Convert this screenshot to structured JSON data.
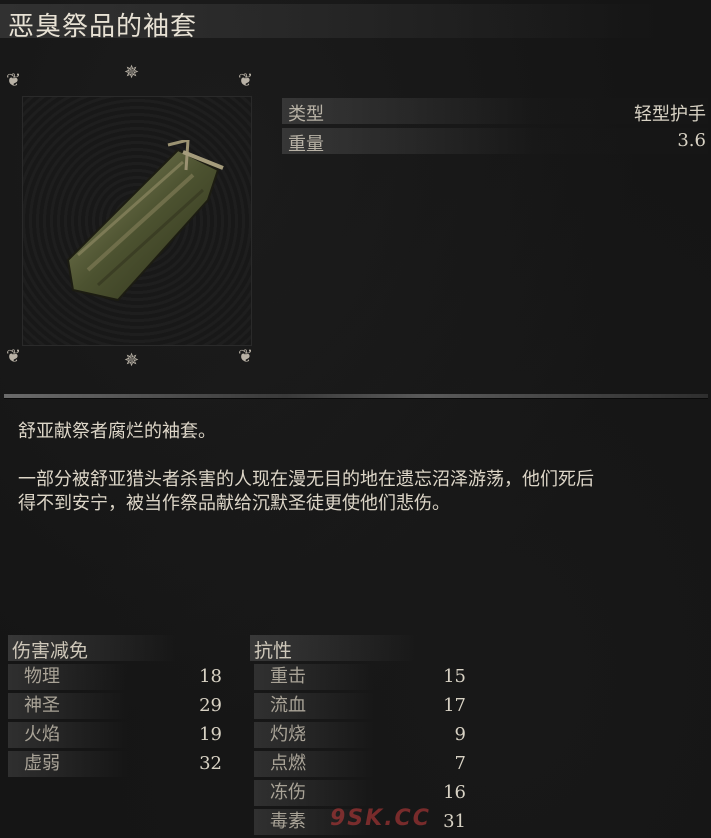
{
  "item": {
    "name": "恶臭祭品的袖套",
    "type_label": "类型",
    "type_value": "轻型护手",
    "weight_label": "重量",
    "weight_value": "3.6"
  },
  "description": [
    "舒亚献祭者腐烂的袖套。",
    "一部分被舒亚猎头者杀害的人现在漫无目的地在遗忘沼泽游荡，他们死后",
    "得不到安宁，被当作祭品献给沉默圣徒更使他们悲伤。"
  ],
  "damage_negation": {
    "title": "伤害减免",
    "rows": [
      {
        "label": "物理",
        "value": "18"
      },
      {
        "label": "神圣",
        "value": "29"
      },
      {
        "label": "火焰",
        "value": "19"
      },
      {
        "label": "虚弱",
        "value": "32"
      }
    ]
  },
  "resistance": {
    "title": "抗性",
    "rows": [
      {
        "label": "重击",
        "value": "15"
      },
      {
        "label": "流血",
        "value": "17"
      },
      {
        "label": "灼烧",
        "value": "9"
      },
      {
        "label": "点燃",
        "value": "7"
      },
      {
        "label": "冻伤",
        "value": "16"
      },
      {
        "label": "毒素",
        "value": "31"
      }
    ]
  },
  "watermark": "9SK.CC"
}
